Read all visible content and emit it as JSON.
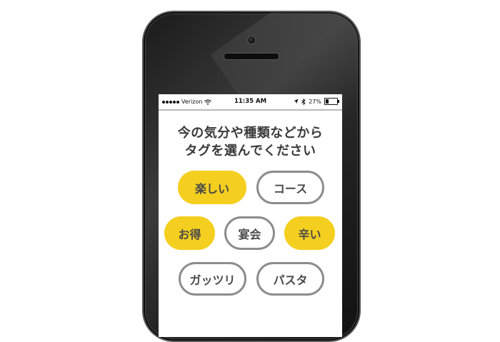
{
  "status_bar": {
    "carrier": "Verizon",
    "time": "11:35 AM",
    "battery_percent": "27%",
    "battery_level": 0.27,
    "icons": [
      "signal-dots-icon",
      "wifi-icon",
      "location-arrow-icon",
      "bluetooth-icon",
      "battery-icon"
    ]
  },
  "prompt": {
    "line1": "今の気分や種類などから",
    "line2": "タグを選んでください"
  },
  "tags": [
    {
      "label": "楽しい",
      "selected": true
    },
    {
      "label": "コース",
      "selected": false
    },
    {
      "label": "お得",
      "selected": true
    },
    {
      "label": "宴会",
      "selected": false
    },
    {
      "label": "辛い",
      "selected": true
    },
    {
      "label": "ガッツリ",
      "selected": false
    },
    {
      "label": "パスタ",
      "selected": false
    }
  ],
  "colors": {
    "selected_tag": "#f5cf1f",
    "unselected_border": "#8c8c8c",
    "text": "#3a3a3a"
  }
}
